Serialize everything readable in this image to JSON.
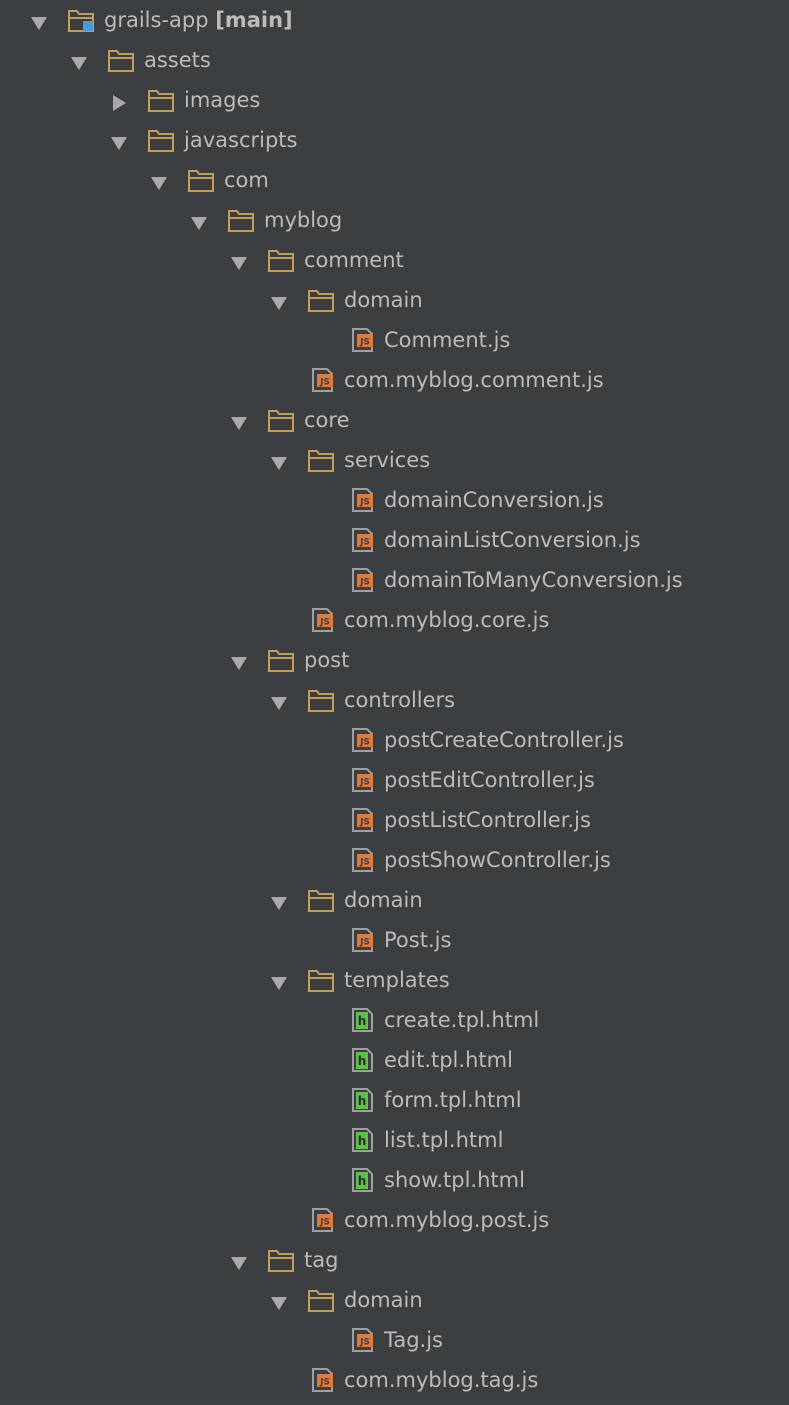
{
  "colors": {
    "background": "#3c3f41",
    "text": "#bbbbbb",
    "folder": "#c69c5a",
    "js_badge": "#e07a3c",
    "html_badge": "#5fbf4a",
    "module_square": "#4a9ad4",
    "arrow": "#a9a9a9"
  },
  "icons": {
    "expanded": "triangle-down-icon",
    "collapsed": "triangle-right-icon",
    "folder": "folder-icon",
    "module": "module-folder-icon",
    "js": "js-file-icon",
    "html": "html-file-icon"
  },
  "tree": [
    {
      "name": "grails-app",
      "branch": "[main]",
      "depth": 0,
      "kind": "module",
      "state": "expanded"
    },
    {
      "name": "assets",
      "depth": 1,
      "kind": "folder",
      "state": "expanded"
    },
    {
      "name": "images",
      "depth": 2,
      "kind": "folder",
      "state": "collapsed"
    },
    {
      "name": "javascripts",
      "depth": 2,
      "kind": "folder",
      "state": "expanded"
    },
    {
      "name": "com",
      "depth": 3,
      "kind": "folder",
      "state": "expanded"
    },
    {
      "name": "myblog",
      "depth": 4,
      "kind": "folder",
      "state": "expanded"
    },
    {
      "name": "comment",
      "depth": 5,
      "kind": "folder",
      "state": "expanded"
    },
    {
      "name": "domain",
      "depth": 6,
      "kind": "folder",
      "state": "expanded"
    },
    {
      "name": "Comment.js",
      "depth": 7,
      "kind": "js"
    },
    {
      "name": "com.myblog.comment.js",
      "depth": 6,
      "kind": "js"
    },
    {
      "name": "core",
      "depth": 5,
      "kind": "folder",
      "state": "expanded"
    },
    {
      "name": "services",
      "depth": 6,
      "kind": "folder",
      "state": "expanded"
    },
    {
      "name": "domainConversion.js",
      "depth": 7,
      "kind": "js"
    },
    {
      "name": "domainListConversion.js",
      "depth": 7,
      "kind": "js"
    },
    {
      "name": "domainToManyConversion.js",
      "depth": 7,
      "kind": "js"
    },
    {
      "name": "com.myblog.core.js",
      "depth": 6,
      "kind": "js"
    },
    {
      "name": "post",
      "depth": 5,
      "kind": "folder",
      "state": "expanded"
    },
    {
      "name": "controllers",
      "depth": 6,
      "kind": "folder",
      "state": "expanded"
    },
    {
      "name": "postCreateController.js",
      "depth": 7,
      "kind": "js"
    },
    {
      "name": "postEditController.js",
      "depth": 7,
      "kind": "js"
    },
    {
      "name": "postListController.js",
      "depth": 7,
      "kind": "js"
    },
    {
      "name": "postShowController.js",
      "depth": 7,
      "kind": "js"
    },
    {
      "name": "domain",
      "depth": 6,
      "kind": "folder",
      "state": "expanded"
    },
    {
      "name": "Post.js",
      "depth": 7,
      "kind": "js"
    },
    {
      "name": "templates",
      "depth": 6,
      "kind": "folder",
      "state": "expanded"
    },
    {
      "name": "create.tpl.html",
      "depth": 7,
      "kind": "html"
    },
    {
      "name": "edit.tpl.html",
      "depth": 7,
      "kind": "html"
    },
    {
      "name": "form.tpl.html",
      "depth": 7,
      "kind": "html"
    },
    {
      "name": "list.tpl.html",
      "depth": 7,
      "kind": "html"
    },
    {
      "name": "show.tpl.html",
      "depth": 7,
      "kind": "html"
    },
    {
      "name": "com.myblog.post.js",
      "depth": 6,
      "kind": "js"
    },
    {
      "name": "tag",
      "depth": 5,
      "kind": "folder",
      "state": "expanded"
    },
    {
      "name": "domain",
      "depth": 6,
      "kind": "folder",
      "state": "expanded"
    },
    {
      "name": "Tag.js",
      "depth": 7,
      "kind": "js"
    },
    {
      "name": "com.myblog.tag.js",
      "depth": 6,
      "kind": "js"
    }
  ]
}
